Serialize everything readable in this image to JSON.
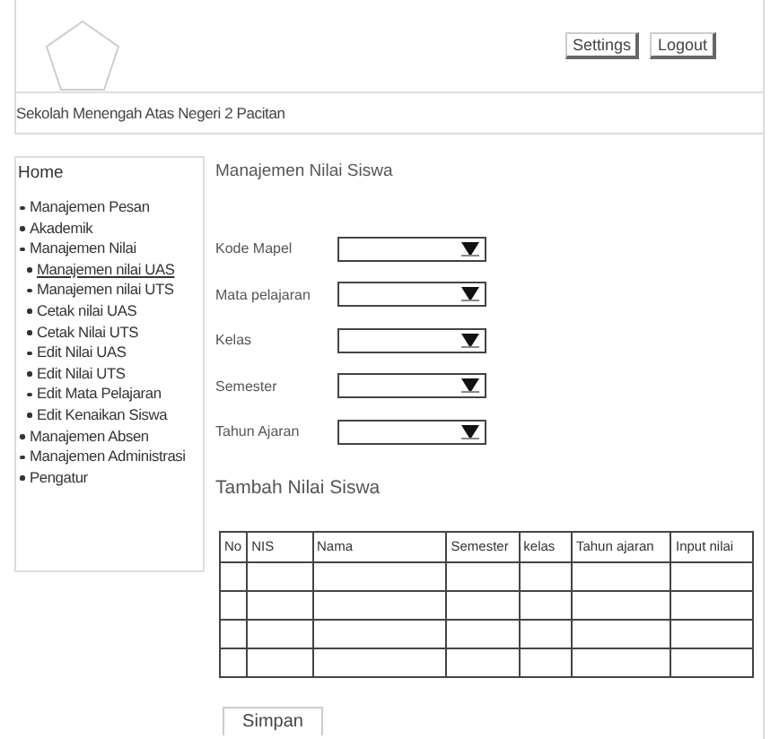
{
  "header": {
    "buttons": [
      "Settings",
      "Logout"
    ]
  },
  "school_name": "Sekolah Menengah Atas Negeri 2 Pacitan",
  "sidebar": {
    "home": "Home",
    "items": [
      {
        "label": "Manajemen Pesan",
        "selected": false
      },
      {
        "label": "Akademik",
        "selected": false
      },
      {
        "label": "Manajemen Nilai",
        "selected": false,
        "children": [
          {
            "label": "Manajemen nilai UAS",
            "selected": true
          },
          {
            "label": "Manajemen nilai UTS",
            "selected": false
          },
          {
            "label": "Cetak nilai UAS",
            "selected": false
          },
          {
            "label": "Cetak Nilai UTS",
            "selected": false
          },
          {
            "label": "Edit Nilai UAS",
            "selected": false
          },
          {
            "label": "Edit Nilai UTS",
            "selected": false
          },
          {
            "label": "Edit Mata Pelajaran",
            "selected": false
          },
          {
            "label": "Edit Kenaikan Siswa",
            "selected": false
          }
        ]
      },
      {
        "label": "Manajemen Absen",
        "selected": false
      },
      {
        "label": "Manajemen Administrasi",
        "selected": false
      },
      {
        "label": "Pengatur",
        "selected": false
      }
    ]
  },
  "main": {
    "title": "Manajemen Nilai Siswa",
    "fields": [
      {
        "label": "Kode Mapel"
      },
      {
        "label": "Mata pelajaran"
      },
      {
        "label": "Kelas"
      },
      {
        "label": "Semester"
      },
      {
        "label": "Tahun Ajaran"
      }
    ],
    "section_title": "Tambah Nilai Siswa",
    "table": {
      "columns": [
        "No",
        "NIS",
        "Nama",
        "Semester",
        "kelas",
        "Tahun ajaran",
        "Input nilai"
      ]
    },
    "save_button": "Simpan"
  }
}
